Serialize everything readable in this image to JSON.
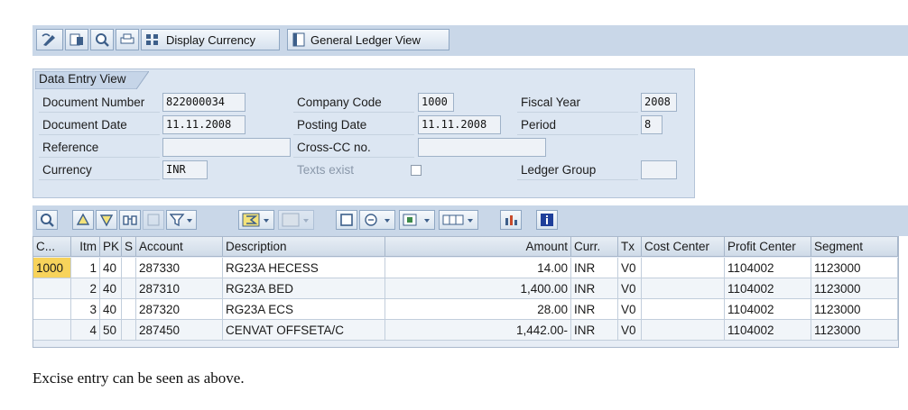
{
  "toolbar": {
    "display_currency_label": "Display Currency",
    "general_ledger_view_label": "General Ledger View"
  },
  "header_panel": {
    "tab_label": "Data Entry View",
    "document_number_label": "Document Number",
    "document_number_value": "822000034",
    "company_code_label": "Company Code",
    "company_code_value": "1000",
    "fiscal_year_label": "Fiscal Year",
    "fiscal_year_value": "2008",
    "document_date_label": "Document Date",
    "document_date_value": "11.11.2008",
    "posting_date_label": "Posting Date",
    "posting_date_value": "11.11.2008",
    "period_label": "Period",
    "period_value": "8",
    "reference_label": "Reference",
    "reference_value": "",
    "cross_cc_label": "Cross-CC no.",
    "cross_cc_value": "",
    "currency_label": "Currency",
    "currency_value": "INR",
    "texts_exist_label": "Texts exist",
    "ledger_group_label": "Ledger Group",
    "ledger_group_value": ""
  },
  "grid": {
    "columns": [
      "C...",
      "Itm",
      "PK",
      "S",
      "Account",
      "Description",
      "Amount",
      "Curr.",
      "Tx",
      "Cost Center",
      "Profit Center",
      "Segment"
    ],
    "rows": [
      {
        "c": "1000",
        "itm": "1",
        "pk": "40",
        "s": "",
        "account": "287330",
        "description": "RG23A HECESS",
        "amount": "14.00",
        "curr": "INR",
        "tx": "V0",
        "cost_center": "",
        "profit_center": "1104002",
        "segment": "1123000"
      },
      {
        "c": "",
        "itm": "2",
        "pk": "40",
        "s": "",
        "account": "287310",
        "description": "RG23A BED",
        "amount": "1,400.00",
        "curr": "INR",
        "tx": "V0",
        "cost_center": "",
        "profit_center": "1104002",
        "segment": "1123000"
      },
      {
        "c": "",
        "itm": "3",
        "pk": "40",
        "s": "",
        "account": "287320",
        "description": "RG23A ECS",
        "amount": "28.00",
        "curr": "INR",
        "tx": "V0",
        "cost_center": "",
        "profit_center": "1104002",
        "segment": "1123000"
      },
      {
        "c": "",
        "itm": "4",
        "pk": "50",
        "s": "",
        "account": "287450",
        "description": "CENVAT OFFSETA/C",
        "amount": "1,442.00-",
        "curr": "INR",
        "tx": "V0",
        "cost_center": "",
        "profit_center": "1104002",
        "segment": "1123000"
      }
    ]
  },
  "caption": "Excise entry can be seen as above.",
  "colors": {
    "toolbar_bg": "#c9d7e8",
    "panel_bg": "#dce6f2",
    "selected_cell": "#f7d35b"
  }
}
